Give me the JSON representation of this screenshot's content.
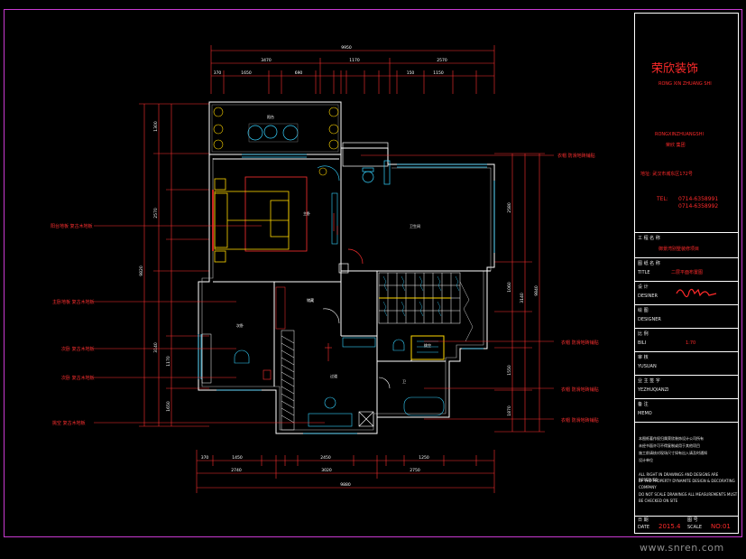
{
  "title_block": {
    "company_name": "荣欣装饰",
    "company_subtitle": "RONG XIN ZHUANG SHI",
    "company_pinyin": "RONGXINZHUANGSHI",
    "company_group": "荣欣 集团",
    "address": "地址: 武汉市城东区172号",
    "tel_label": "TEL:",
    "tel_1": "0714-6358991",
    "tel_2": "0714-6358992",
    "project_label_cn": "工 程 名 称",
    "project_name": "御景湾别墅装修项目",
    "drawing_label_cn": "图 纸 名 称",
    "title_label": "TITLE",
    "drawing_name": "二层平面布置图",
    "designer_label_cn": "设 计",
    "designer_label": "DESINER",
    "design_label_cn": "绘 图",
    "design_label": "DESIGNER",
    "scale_label_cn": "比 例",
    "scale_label": "BILI",
    "scale_value": "1:70",
    "yusuan_label_cn": "审 核",
    "yusuan_label": "YUSUAN",
    "lead_label_cn": "业 主 签 字",
    "lead_label": "YEZHUQIANZI",
    "memo_label_cn": "备 注",
    "memo_label": "MEMO",
    "notes_cn_1": "本图纸著作权归属荣欣装饰设计公司所有",
    "notes_cn_2": "未经书面许可不得复制或用于其他项目",
    "notes_cn_3": "施工前请核对现场尺寸如有出入请及时通知",
    "notes_cn_4": "设计单位",
    "notes_en_1": "ALL RIGHT IN DRAWINGS AND DESIGNS ARE RESERVED",
    "notes_en_2": "BY THE PROPERTY DYNAMITE DESIGN & DECORATING",
    "notes_en_3": "COMPANY",
    "notes_en_4": "DO NOT SCALE DRAWINGS ALL MEASUREMENTS MUST",
    "notes_en_5": "BE CHECKED ON SITE",
    "date_label_cn": "日 期",
    "date_label": "DATE",
    "date_value": "2015.4",
    "page_label_cn": "图 号",
    "page_label": "SCALE",
    "page_value": "NO:01"
  },
  "dims_top": {
    "total": "9950",
    "seg1": "3470",
    "seg2": "1170",
    "seg3": "2570",
    "sub": [
      "370",
      "1650",
      "150",
      "690",
      "150",
      "240",
      "100",
      "240",
      "150",
      "1150",
      "150",
      "240"
    ]
  },
  "dims_bottom": {
    "total": "9880",
    "seg1": "2740",
    "seg2": "3020",
    "seg3": "2750",
    "sub": [
      "370",
      "1450",
      "280",
      "140",
      "2450",
      "240",
      "150",
      "580",
      "1250",
      "150"
    ]
  },
  "dims_left": {
    "total": "9820",
    "a": "1300",
    "b": "2570",
    "c": "3140",
    "d": "1170",
    "e": "1650"
  },
  "dims_right": {
    "total": "9840",
    "a": "2580",
    "b": "1060",
    "c": "3140",
    "d": "1550",
    "e": "1870"
  },
  "rooms": {
    "balcony": "阳台",
    "master_bed": "主卧",
    "bath1": "卫生间",
    "storage": "储藏",
    "bed2": "次卧",
    "hall": "过道",
    "bath2": "卫生间",
    "void": "挑空",
    "bath3": "卫"
  },
  "callouts_left": [
    "阳台地板 复古木地板",
    "主卧地板 复古木地板",
    "次卧 复古木地板",
    "次卧 复古木地板",
    "挑空 复古木地板"
  ],
  "callouts_right": [
    "衣帽 防滑地砖铺贴",
    "衣帽 防滑地砖铺贴",
    "衣帽 防滑地砖铺贴",
    "衣帽 防滑地砖铺贴"
  ],
  "watermark": "www.snren.com",
  "colors": {
    "frame": "#c83ad1",
    "wall": "#ffffff",
    "dimension": "#ff3030",
    "furniture_yellow": "#ffd700",
    "furniture_blue": "#35d2ff",
    "label_blue": "#3d7bff"
  }
}
